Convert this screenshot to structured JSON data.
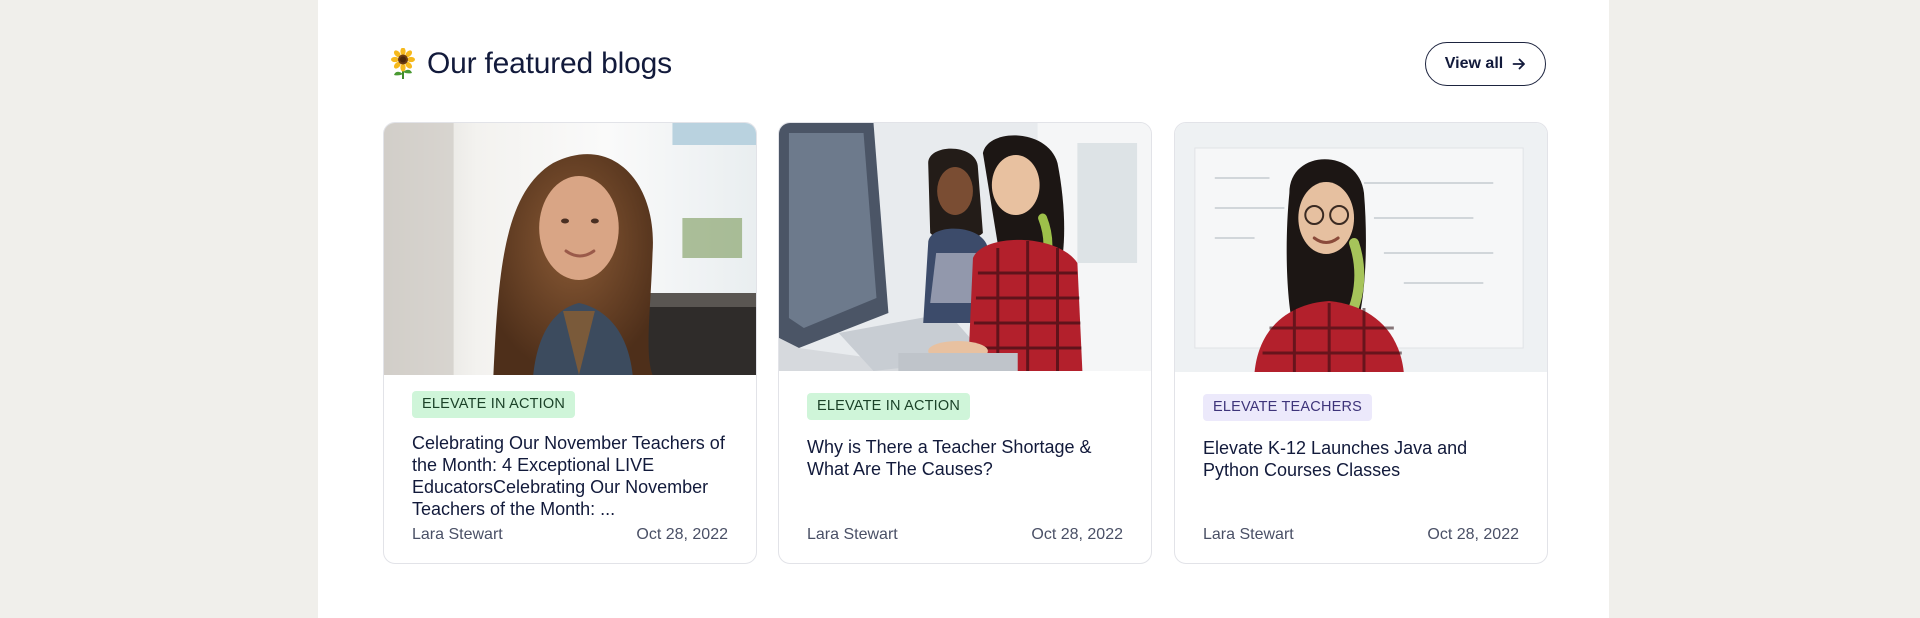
{
  "section": {
    "title": "Our featured blogs",
    "title_icon": "sunflower-icon",
    "view_all_label": "View all",
    "view_all_icon": "arrow-right-icon"
  },
  "colors": {
    "page_bg": "#f0efeb",
    "panel_bg": "#ffffff",
    "text_primary": "#121a3b",
    "tag_green_bg": "#cff5d9",
    "tag_purple_bg": "#ece9fb"
  },
  "blogs": [
    {
      "tag": "ELEVATE IN ACTION",
      "tag_style": "green",
      "title": "Celebrating Our November Teachers of the Month: 4 Exceptional LIVE EducatorsCelebrating Our November Teachers of the Month: ...",
      "author": "Lara Stewart",
      "date": "Oct 28, 2022",
      "image": "photo of a smiling woman with long wavy hair"
    },
    {
      "tag": "ELEVATE IN ACTION",
      "tag_style": "green",
      "title": "Why is There a Teacher Shortage & What Are The Causes?",
      "author": "Lara Stewart",
      "date": "Oct 28, 2022",
      "image": "photo of two women working at a computer"
    },
    {
      "tag": "ELEVATE TEACHERS",
      "tag_style": "purple",
      "title": "Elevate K-12 Launches Java and Python Courses Classes",
      "author": "Lara Stewart",
      "date": "Oct 28, 2022",
      "image": "photo of a smiling woman in a plaid shirt near a whiteboard"
    }
  ]
}
